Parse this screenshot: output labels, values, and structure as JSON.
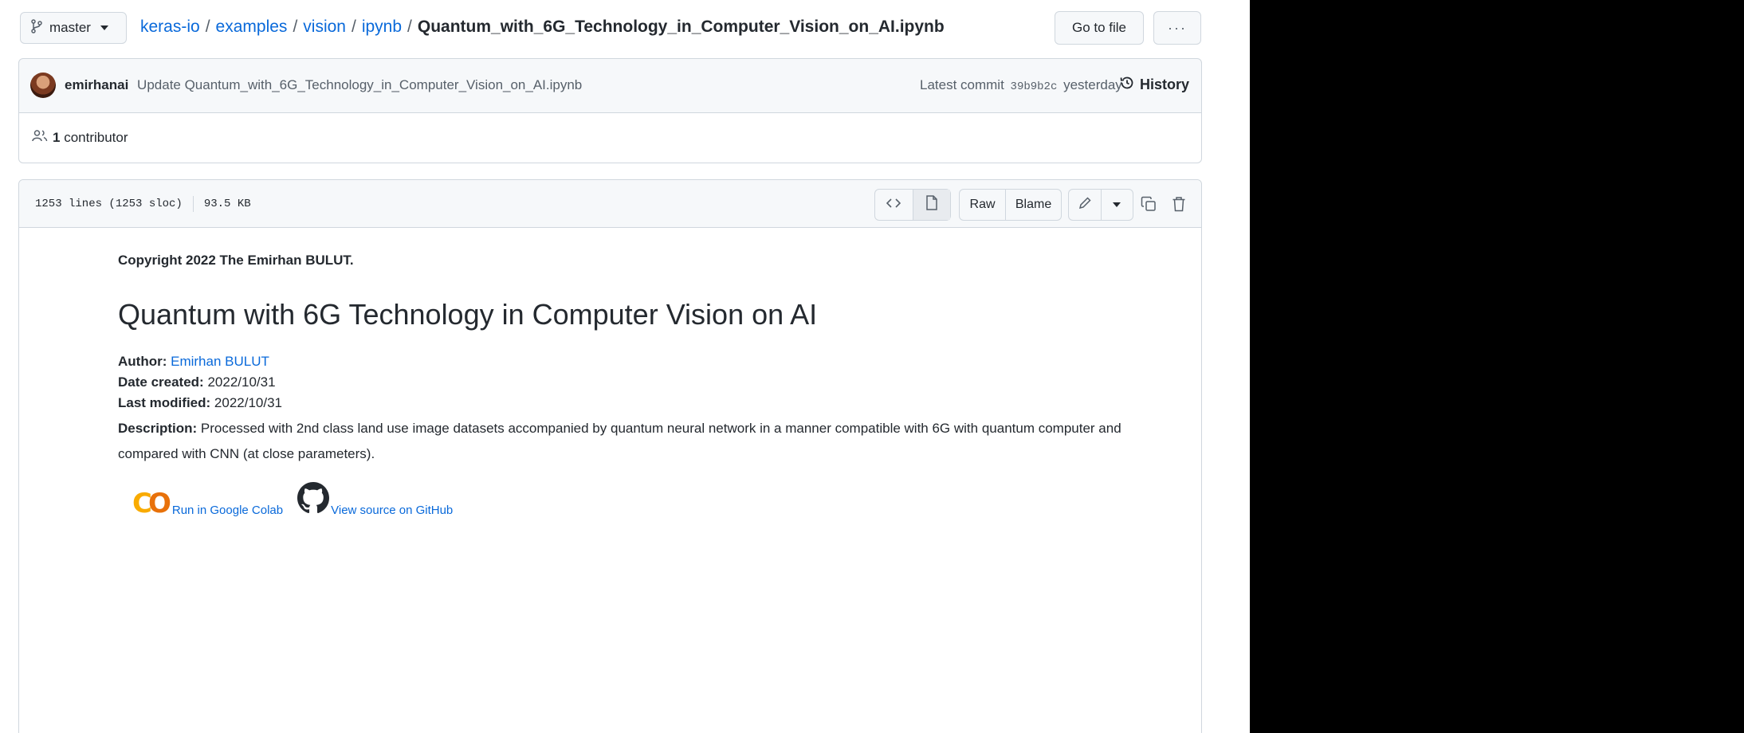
{
  "branch": {
    "label": "master"
  },
  "breadcrumb": {
    "items": [
      "keras-io",
      "examples",
      "vision",
      "ipynb"
    ],
    "separator": "/",
    "current": "Quantum_with_6G_Technology_in_Computer_Vision_on_AI.ipynb"
  },
  "actions": {
    "go_to_file": "Go to file",
    "more": "···"
  },
  "commit": {
    "author": "emirhanai",
    "message": "Update Quantum_with_6G_Technology_in_Computer_Vision_on_AI.ipynb",
    "latest_label": "Latest commit",
    "sha": "39b9b2c",
    "when": "yesterday",
    "history_label": "History"
  },
  "contributors": {
    "count": "1",
    "label": "contributor"
  },
  "file": {
    "lines": "1253 lines (1253 sloc)",
    "size": "93.5 KB",
    "raw_label": "Raw",
    "blame_label": "Blame"
  },
  "notebook": {
    "copyright": "Copyright 2022 The Emirhan BULUT.",
    "title": "Quantum with 6G Technology in Computer Vision on AI",
    "author_label": "Author:",
    "author_value": "Emirhan BULUT",
    "created_label": "Date created:",
    "created_value": "2022/10/31",
    "modified_label": "Last modified:",
    "modified_value": "2022/10/31",
    "description_label": "Description:",
    "description_value": "Processed with 2nd class land use image datasets accompanied by quantum neural network in a manner compatible with 6G with quantum computer and compared with CNN (at close parameters).",
    "colab_link": "Run in Google Colab",
    "github_link": "View source on GitHub",
    "colab_logo_text": "CO"
  },
  "colors": {
    "link": "#0969da",
    "border": "#d0d7de",
    "header_bg": "#f6f8fa",
    "colab_yellow": "#f9ab00",
    "colab_orange": "#e8710a"
  }
}
